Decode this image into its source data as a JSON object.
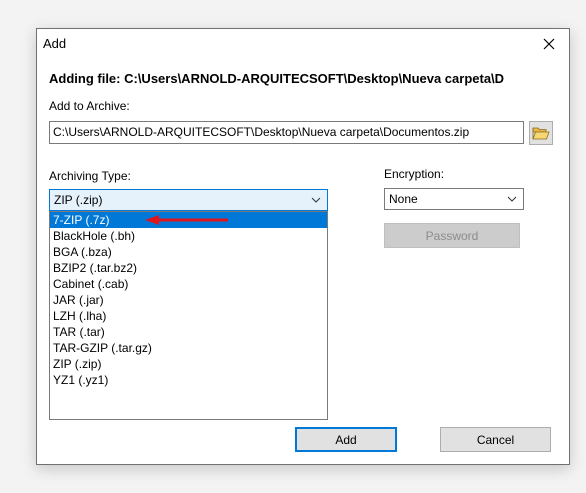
{
  "dialog": {
    "title": "Add",
    "heading": "Adding file: C:\\Users\\ARNOLD-ARQUITECSOFT\\Desktop\\Nueva carpeta\\D"
  },
  "archive": {
    "label": "Add to Archive:",
    "path": "C:\\Users\\ARNOLD-ARQUITECSOFT\\Desktop\\Nueva carpeta\\Documentos.zip"
  },
  "archiving_type": {
    "label": "Archiving Type:",
    "selected": "ZIP (.zip)",
    "options": [
      "7-ZIP (.7z)",
      "BlackHole (.bh)",
      "BGA (.bza)",
      "BZIP2 (.tar.bz2)",
      "Cabinet (.cab)",
      "JAR (.jar)",
      "LZH (.lha)",
      "TAR (.tar)",
      "TAR-GZIP (.tar.gz)",
      "ZIP (.zip)",
      "YZ1 (.yz1)"
    ],
    "highlighted_index": 0
  },
  "encryption": {
    "label": "Encryption:",
    "selected": "None",
    "password_label": "Password"
  },
  "buttons": {
    "add": "Add",
    "cancel": "Cancel"
  },
  "colors": {
    "accent": "#0078d7",
    "arrow": "#e0141b"
  },
  "icons": {
    "close": "close-icon",
    "browse": "open-folder-icon",
    "dropdown": "chevron-down-icon",
    "annotation": "red-arrow-icon"
  }
}
